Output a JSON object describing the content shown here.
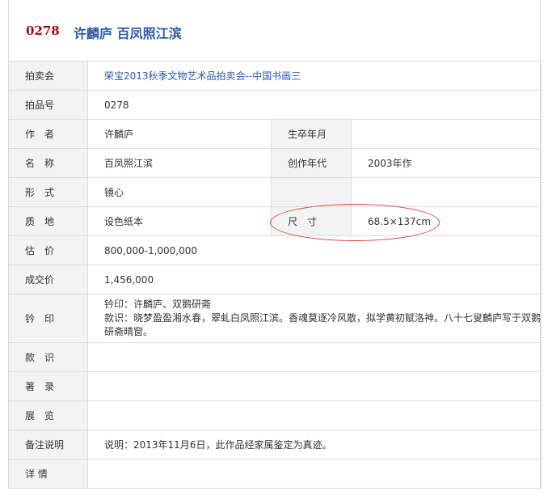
{
  "header": {
    "lot_no": "0278",
    "title": "许麟庐 百凤照江滨"
  },
  "rows": {
    "auction": {
      "label": "拍卖会",
      "value": "荣宝2013秋季文物艺术品拍卖会--中国书画三"
    },
    "lot": {
      "label": "拍品号",
      "value": "0278"
    },
    "artist": {
      "label": "作　者",
      "value": "许麟庐",
      "label2": "生卒年月",
      "value2": ""
    },
    "name": {
      "label": "名　称",
      "value": "百凤照江滨",
      "label2": "创作年代",
      "value2": "2003年作"
    },
    "form": {
      "label": "形　式",
      "value": "镜心",
      "label2": "",
      "value2": ""
    },
    "material": {
      "label": "质　地",
      "value": "设色纸本",
      "label2": "尺　寸",
      "value2": "68.5×137cm"
    },
    "estimate": {
      "label": "估　价",
      "value": "800,000-1,000,000"
    },
    "sold": {
      "label": "成交价",
      "value": "1,456,000"
    },
    "seal": {
      "label": "钤　印",
      "line1": "钤印：许麟庐、双鹅研斋",
      "line2": "款识：晓梦盈盈湘水春，翠虬白凤照江滨。香魂莫逐冷风散，拟学黄初赋洛神。八十七叟麟庐写于双鹅",
      "line3": "研斋晴窗。"
    },
    "inscription": {
      "label": "款　识",
      "value": ""
    },
    "record": {
      "label": "著　录",
      "value": ""
    },
    "exhibit": {
      "label": "展　览",
      "value": ""
    },
    "note": {
      "label": "备注说明",
      "value": "说明：2013年11月6日，此作品经家属鉴定为真迹。"
    },
    "detail": {
      "label": "详 情",
      "value": ""
    }
  }
}
